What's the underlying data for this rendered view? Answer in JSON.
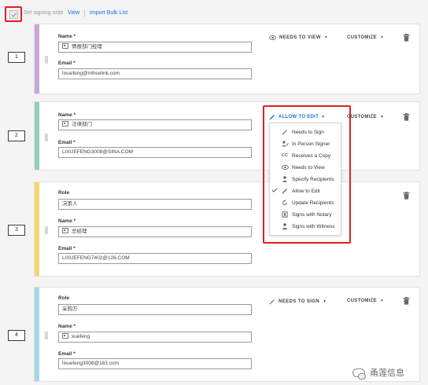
{
  "topbar": {
    "set_signing_order": "Set signing order",
    "set_signing_order_checked": true,
    "view_link": "View",
    "import_link": "Import Bulk List"
  },
  "recipients": [
    {
      "number": "1",
      "color": "#c5a9d5",
      "name_label": "Name *",
      "name_value": "情报部门经理",
      "email_label": "Email *",
      "email_value": "lixuefeng@mfreelink.com",
      "action_label": "NEEDS TO VIEW",
      "action_icon": "eye-icon",
      "customize": "CUSTOMIZE"
    },
    {
      "number": "2",
      "color": "#94ccbb",
      "name_label": "Name *",
      "name_value": "法律部门",
      "email_label": "Email *",
      "email_value": "LIXUEFENG3008@SINA.COM",
      "action_label": "ALLOW TO EDIT",
      "action_icon": "pencil-icon",
      "customize": "CUSTOMIZE"
    },
    {
      "number": "3",
      "color": "#f6d56a",
      "role_label": "Role",
      "role_value": "决策人",
      "name_label": "Name *",
      "name_value": "总经理",
      "email_label": "Email *",
      "email_value": "LIXUEFENG7402@126.COM"
    },
    {
      "number": "4",
      "color": "#a6d6e2",
      "role_label": "Role",
      "role_value": "采购方",
      "name_label": "Name *",
      "name_value": "xuefeng",
      "email_label": "Email *",
      "email_value": "lixuefeng3008@163.com",
      "action_label": "NEEDS TO SIGN",
      "action_icon": "pen-icon",
      "customize": "CUSTOMIZE"
    }
  ],
  "dropdown": {
    "trigger_label": "ALLOW TO EDIT",
    "selected": "Allow to Edit",
    "items": [
      {
        "label": "Needs to Sign",
        "icon": "pen-icon"
      },
      {
        "label": "In Person Signer",
        "icon": "in-person-icon"
      },
      {
        "label": "Receives a Copy",
        "icon": "cc-icon"
      },
      {
        "label": "Needs to View",
        "icon": "eye-icon"
      },
      {
        "label": "Specify Recipients",
        "icon": "person-icon"
      },
      {
        "label": "Allow to Edit",
        "icon": "pencil-icon"
      },
      {
        "label": "Update Recipients",
        "icon": "update-icon"
      },
      {
        "label": "Signs with Notary",
        "icon": "notary-icon"
      },
      {
        "label": "Signs with Witness",
        "icon": "witness-icon"
      }
    ]
  },
  "watermark": "甬莲信息",
  "colors": {
    "accent_blue": "#1473e6",
    "highlight_red": "#e02020"
  }
}
